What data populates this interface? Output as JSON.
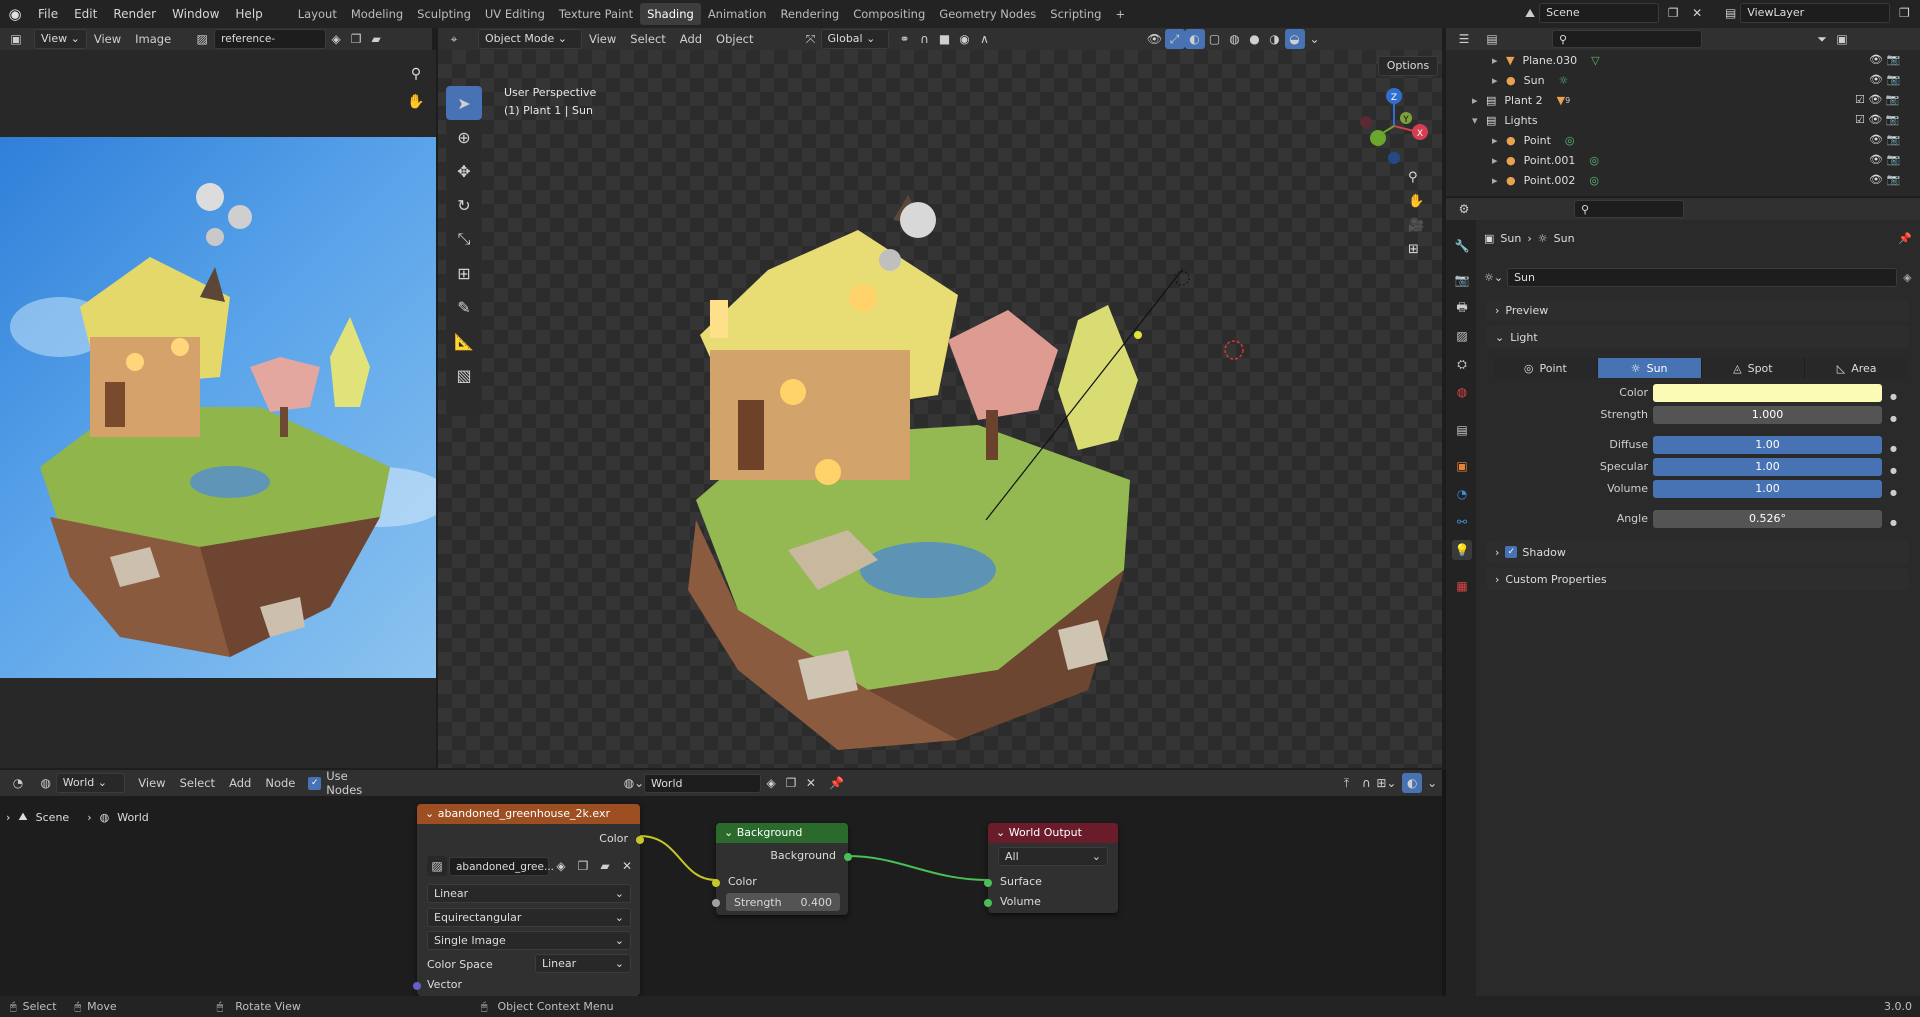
{
  "topbar": {
    "menus": [
      "File",
      "Edit",
      "Render",
      "Window",
      "Help"
    ],
    "workspaces": [
      "Layout",
      "Modeling",
      "Sculpting",
      "UV Editing",
      "Texture Paint",
      "Shading",
      "Animation",
      "Rendering",
      "Compositing",
      "Geometry Nodes",
      "Scripting"
    ],
    "active_workspace": "Shading",
    "add_tab": "+",
    "scene": "Scene",
    "view_layer": "ViewLayer"
  },
  "image_editor": {
    "view_dropdown": "View",
    "menus": [
      "View",
      "Image"
    ],
    "image_name": "reference-image.png"
  },
  "viewport": {
    "mode": "Object Mode",
    "menus": [
      "View",
      "Select",
      "Add",
      "Object"
    ],
    "orientation": "Global",
    "options": "Options",
    "overlay_line1": "User Perspective",
    "overlay_line2": "(1) Plant 1 | Sun",
    "gizmo": {
      "x": "X",
      "y": "Y",
      "z": "Z"
    }
  },
  "outliner": {
    "rows": [
      {
        "name": "Plane.030",
        "indent": 3
      },
      {
        "name": "Sun",
        "indent": 3
      },
      {
        "name": "Plant 2",
        "indent": 1
      },
      {
        "name": "Lights",
        "indent": 1
      },
      {
        "name": "Point",
        "indent": 2
      },
      {
        "name": "Point.001",
        "indent": 2
      },
      {
        "name": "Point.002",
        "indent": 2
      }
    ],
    "badge": "9"
  },
  "properties": {
    "breadcrumb_obj": "Sun",
    "breadcrumb_data": "Sun",
    "datablock": "Sun",
    "preview": "Preview",
    "light": "Light",
    "light_types": [
      "Point",
      "Sun",
      "Spot",
      "Area"
    ],
    "active_type": "Sun",
    "color_label": "Color",
    "color_value": "#fbfbb6",
    "strength_label": "Strength",
    "strength": "1.000",
    "diffuse_label": "Diffuse",
    "diffuse": "1.00",
    "specular_label": "Specular",
    "specular": "1.00",
    "volume_label": "Volume",
    "volume": "1.00",
    "angle_label": "Angle",
    "angle": "0.526°",
    "shadow": "Shadow",
    "custom": "Custom Properties"
  },
  "node_editor": {
    "type": "World",
    "menus": [
      "View",
      "Select",
      "Add",
      "Node"
    ],
    "use_nodes": "Use Nodes",
    "world_name": "World",
    "breadcrumb": [
      "Scene",
      "World"
    ],
    "env_node": {
      "title": "abandoned_greenhouse_2k.exr",
      "output": "Color",
      "image": "abandoned_gree...",
      "interpolation": "Linear",
      "projection": "Equirectangular",
      "source": "Single Image",
      "colorspace_label": "Color Space",
      "colorspace": "Linear",
      "input": "Vector"
    },
    "bg_node": {
      "title": "Background",
      "output": "Background",
      "color": "Color",
      "strength_label": "Strength",
      "strength": "0.400"
    },
    "out_node": {
      "title": "World Output",
      "target": "All",
      "surface": "Surface",
      "volume": "Volume"
    }
  },
  "statusbar": {
    "select": "Select",
    "move": "Move",
    "rotate": "Rotate View",
    "context": "Object Context Menu",
    "version": "3.0.0"
  }
}
